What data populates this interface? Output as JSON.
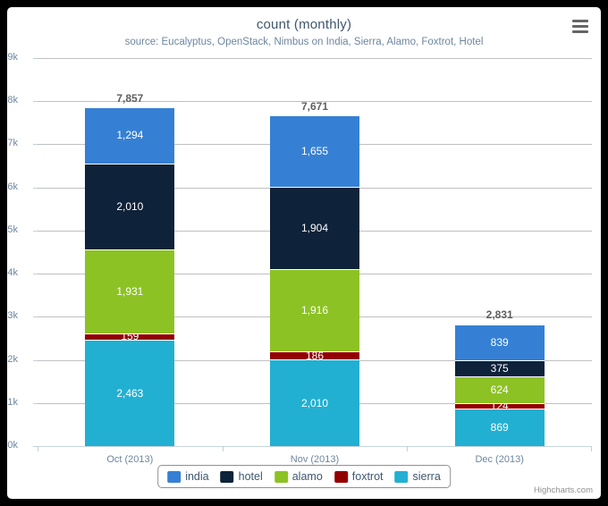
{
  "chart": {
    "title": "count (monthly)",
    "subtitle": "source: Eucalyptus, OpenStack, Nimbus on India, Sierra, Alamo, Foxtrot, Hotel",
    "credits": "Highcharts.com",
    "context_menu_icon": "hamburger-menu-icon"
  },
  "chart_data": {
    "type": "bar",
    "stacked": true,
    "title": "count (monthly)",
    "subtitle": "source: Eucalyptus, OpenStack, Nimbus on India, Sierra, Alamo, Foxtrot, Hotel",
    "xlabel": "",
    "ylabel": "",
    "ylim": [
      0,
      9000
    ],
    "grid": true,
    "legend_position": "bottom",
    "categories": [
      "Oct (2013)",
      "Nov (2013)",
      "Dec (2013)"
    ],
    "ytick_labels": [
      "0k",
      "1k",
      "2k",
      "3k",
      "4k",
      "5k",
      "6k",
      "7k",
      "8k",
      "9k"
    ],
    "ytick_values": [
      0,
      1000,
      2000,
      3000,
      4000,
      5000,
      6000,
      7000,
      8000,
      9000
    ],
    "series": [
      {
        "name": "india",
        "color": "#3580d4",
        "values": [
          1294,
          1655,
          839
        ],
        "labels": [
          "1,294",
          "1,655",
          "839"
        ]
      },
      {
        "name": "hotel",
        "color": "#0e2239",
        "values": [
          2010,
          1904,
          375
        ],
        "labels": [
          "2,010",
          "1,904",
          "375"
        ]
      },
      {
        "name": "alamo",
        "color": "#8cc224",
        "values": [
          1931,
          1916,
          624
        ],
        "labels": [
          "1,931",
          "1,916",
          "624"
        ]
      },
      {
        "name": "foxtrot",
        "color": "#930000",
        "values": [
          159,
          186,
          124
        ],
        "labels": [
          "159",
          "186",
          "124"
        ]
      },
      {
        "name": "sierra",
        "color": "#22b0d2",
        "values": [
          2463,
          2010,
          869
        ],
        "labels": [
          "2,463",
          "2,010",
          "869"
        ]
      }
    ],
    "stack_totals": [
      7857,
      7671,
      2831
    ],
    "stack_total_labels": [
      "7,857",
      "7,671",
      "2,831"
    ]
  }
}
